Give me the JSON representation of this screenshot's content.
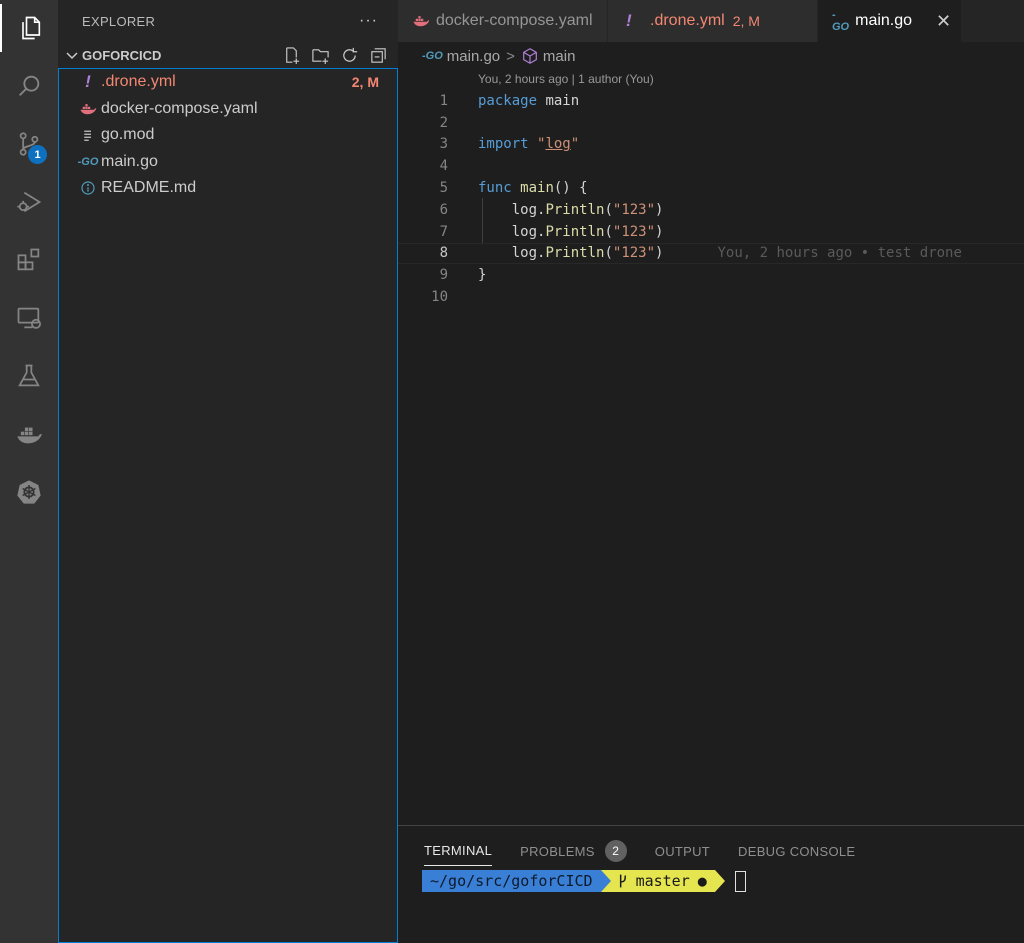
{
  "activity_bar": {
    "items": [
      "explorer-icon",
      "search-icon",
      "source-control-icon",
      "run-debug-icon",
      "extensions-icon",
      "remote-explorer-icon",
      "testing-icon",
      "docker-icon",
      "kubernetes-icon"
    ],
    "source_control_badge": "1"
  },
  "sidebar": {
    "title": "EXPLORER",
    "more": "···",
    "folder": "GOFORCICD",
    "files": [
      {
        "name": ".drone.yml",
        "icon": "exclamation-icon",
        "status": "2, M",
        "modified": true
      },
      {
        "name": "docker-compose.yaml",
        "icon": "docker-file-icon",
        "status": "",
        "modified": false
      },
      {
        "name": "go.mod",
        "icon": "lines-icon",
        "status": "",
        "modified": false
      },
      {
        "name": "main.go",
        "icon": "go-icon",
        "status": "",
        "modified": false
      },
      {
        "name": "README.md",
        "icon": "info-icon",
        "status": "",
        "modified": false
      }
    ]
  },
  "tabs": [
    {
      "label": "docker-compose.yaml",
      "icon": "docker-file-icon",
      "status": ""
    },
    {
      "label": ".drone.yml",
      "icon": "exclamation-icon",
      "status": "2, M"
    },
    {
      "label": "main.go",
      "icon": "go-icon",
      "status": "",
      "close": "✕"
    }
  ],
  "breadcrumb": {
    "file": "main.go",
    "separator": ">",
    "symbol": "main"
  },
  "editor": {
    "codelens": "You, 2 hours ago | 1 author (You)",
    "current_line": 8,
    "lines": [
      {
        "n": "1",
        "text": "package main"
      },
      {
        "n": "2",
        "text": ""
      },
      {
        "n": "3",
        "text": "import \"log\""
      },
      {
        "n": "4",
        "text": ""
      },
      {
        "n": "5",
        "text": "func main() {"
      },
      {
        "n": "6",
        "text": "    log.Println(\"123\")"
      },
      {
        "n": "7",
        "text": "    log.Println(\"123\")"
      },
      {
        "n": "8",
        "text": "    log.Println(\"123\")"
      },
      {
        "n": "9",
        "text": "}"
      },
      {
        "n": "10",
        "text": ""
      }
    ],
    "blame": "You, 2 hours ago • test drone"
  },
  "panel": {
    "tabs": [
      "TERMINAL",
      "PROBLEMS",
      "OUTPUT",
      "DEBUG CONSOLE"
    ],
    "problems_count": "2",
    "prompt_path": "~/go/src/goforCICD",
    "git_branch": "master",
    "git_dirty": "●"
  },
  "colors": {
    "accent": "#007fd4",
    "modified": "#f48771",
    "prompt_path_bg": "#3a7fd6",
    "prompt_git_bg": "#e5e54f"
  }
}
